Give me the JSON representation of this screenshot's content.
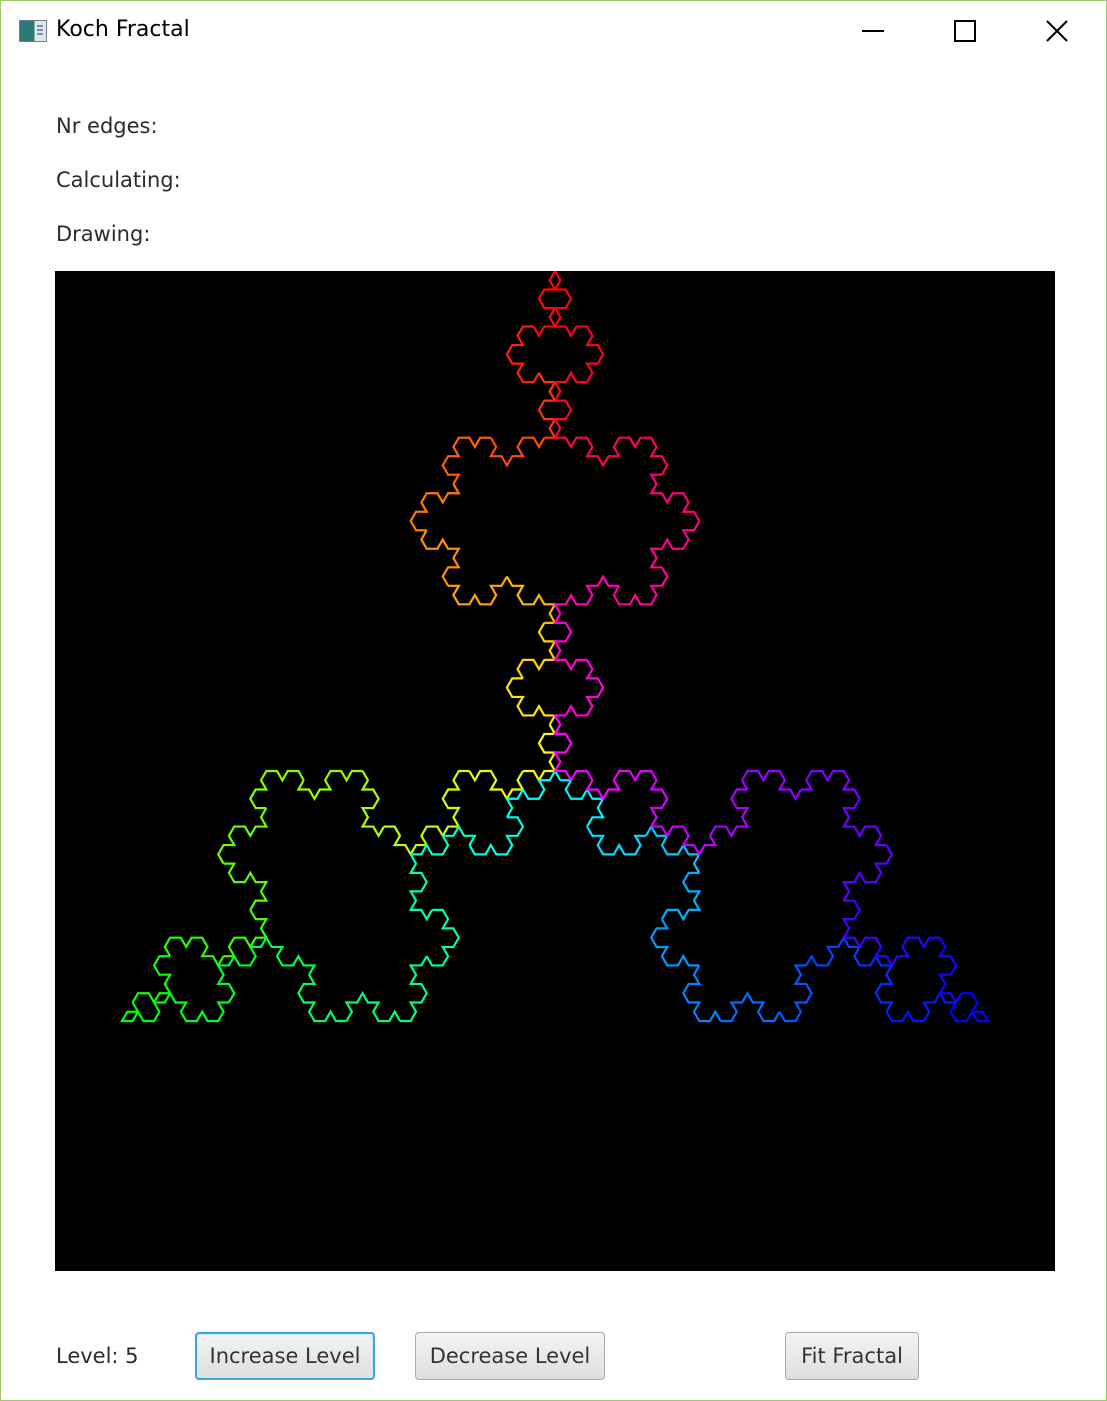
{
  "window": {
    "title": "Koch Fractal",
    "controls": {
      "minimize_glyph": "—",
      "maximize_glyph": "☐",
      "close_glyph": "✕"
    },
    "border_color": "#9cc96b"
  },
  "stats": {
    "nr_edges_label": "Nr edges:",
    "calculating_label": "Calculating:",
    "drawing_label": "Drawing:"
  },
  "canvas": {
    "background": "#000000",
    "fractal": "koch-snowflake",
    "level": 5,
    "coloring": "rainbow-hue-by-edge-index"
  },
  "controls": {
    "level_text": "Level: 5",
    "increase_label": "Increase Level",
    "decrease_label": "Decrease Level",
    "fit_label": "Fit Fractal"
  },
  "icons": {
    "app": "app-icon",
    "minimize": "minimize-icon",
    "maximize": "maximize-icon",
    "close": "close-icon"
  }
}
